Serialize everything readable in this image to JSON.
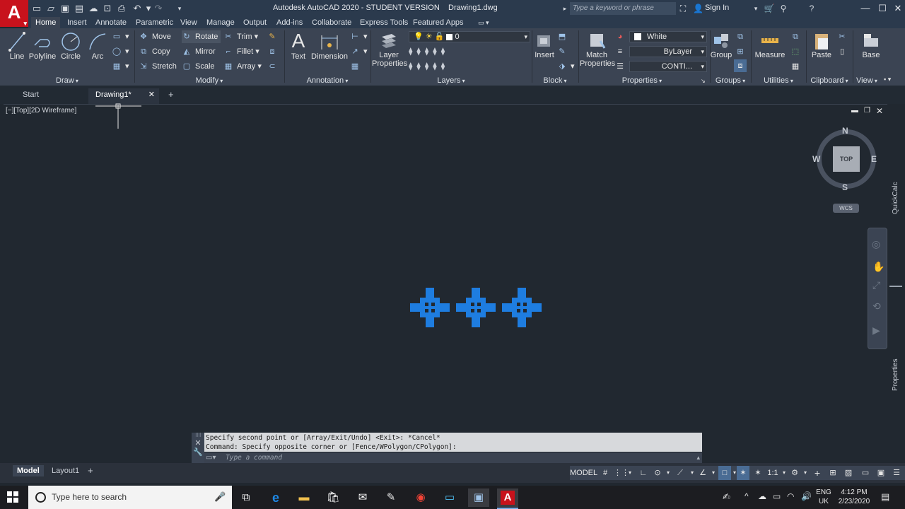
{
  "app": {
    "logo_letter": "A",
    "title": "Autodesk AutoCAD 2020 - STUDENT VERSION    Drawing1.dwg",
    "search_placeholder": "Type a keyword or phrase",
    "signin": "Sign In"
  },
  "ribbon_tabs": [
    "Home",
    "Insert",
    "Annotate",
    "Parametric",
    "View",
    "Manage",
    "Output",
    "Add-ins",
    "Collaborate",
    "Express Tools",
    "Featured Apps"
  ],
  "draw": {
    "label": "Draw",
    "line": "Line",
    "polyline": "Polyline",
    "circle": "Circle",
    "arc": "Arc"
  },
  "modify": {
    "label": "Modify",
    "move": "Move",
    "rotate": "Rotate",
    "trim": "Trim",
    "copy": "Copy",
    "mirror": "Mirror",
    "fillet": "Fillet",
    "stretch": "Stretch",
    "scale": "Scale",
    "array": "Array"
  },
  "annotation": {
    "label": "Annotation",
    "text": "Text",
    "dimension": "Dimension"
  },
  "layers": {
    "label": "Layers",
    "layer_properties_1": "Layer",
    "layer_properties_2": "Properties",
    "current_layer": "0"
  },
  "block": {
    "label": "Block",
    "insert": "Insert"
  },
  "properties": {
    "label": "Properties",
    "match_1": "Match",
    "match_2": "Properties",
    "color": "White",
    "lineweight": "ByLayer",
    "linetype": "CONTI..."
  },
  "groups": {
    "label": "Groups",
    "group": "Group"
  },
  "utilities": {
    "label": "Utilities",
    "measure": "Measure"
  },
  "clipboard": {
    "label": "Clipboard",
    "paste": "Paste"
  },
  "view": {
    "label": "View",
    "base": "Base"
  },
  "doc_tabs": {
    "start": "Start",
    "drawing": "Drawing1*"
  },
  "viewport": {
    "label": "[−][Top][2D Wireframe]",
    "compass_n": "N",
    "compass_s": "S",
    "compass_e": "E",
    "compass_w": "W",
    "cube_face": "TOP",
    "wcs": "WCS",
    "quickcalc": "QuickCalc",
    "properties_palette": "Properties"
  },
  "command": {
    "history_1": "Specify second point or [Array/Exit/Undo] <Exit>: *Cancel*",
    "history_2": "Command: Specify opposite corner or [Fence/WPolygon/CPolygon]:",
    "placeholder": "Type a command"
  },
  "layout_tabs": [
    "Model",
    "Layout1"
  ],
  "status": {
    "model": "MODEL",
    "scale": "1:1"
  },
  "taskbar": {
    "search": "Type here to search",
    "lang_1": "ENG",
    "lang_2": "UK",
    "time": "4:12 PM",
    "date": "2/23/2020"
  },
  "colors": {
    "accent": "#1e88e5",
    "grip": "#1e7de0",
    "logo": "#c8121c"
  }
}
